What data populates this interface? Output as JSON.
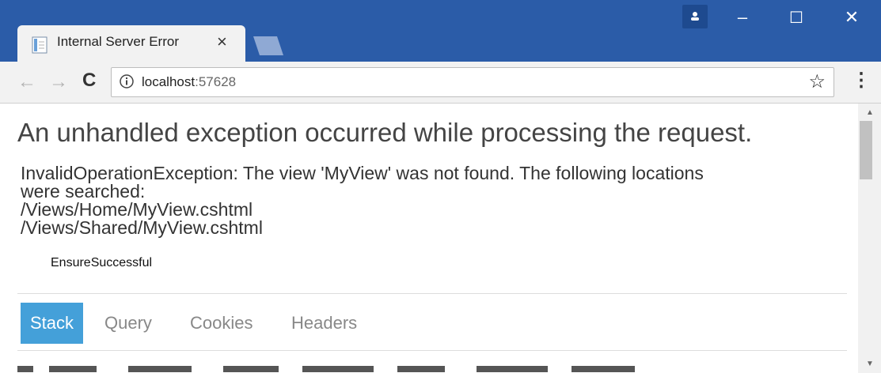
{
  "browser": {
    "tab_title": "Internal Server Error",
    "tab_close": "×",
    "window_minimize": "–",
    "window_maximize": "☐",
    "window_close": "✕",
    "nav_back": "←",
    "nav_forward": "→",
    "reload": "C",
    "address_host": "localhost",
    "address_port": ":57628",
    "bookmark_star": "☆",
    "menu_dots": "⋮"
  },
  "page": {
    "heading": "An unhandled exception occurred while processing the request.",
    "message_line1": "InvalidOperationException: The view 'MyView' was not found. The following locations",
    "message_line2": "were searched:",
    "message_line3": "/Views/Home/MyView.cshtml",
    "message_line4": "/Views/Shared/MyView.cshtml",
    "source": "EnsureSuccessful",
    "tabs": [
      {
        "label": "Stack"
      },
      {
        "label": "Query"
      },
      {
        "label": "Cookies"
      },
      {
        "label": "Headers"
      }
    ],
    "accent_color": "#44a0d9"
  },
  "colors": {
    "titlebar": "#2b5ca8",
    "toolbar": "#f2f2f2"
  },
  "icons": [
    "document-icon",
    "new-tab-icon",
    "profile-icon",
    "info-icon",
    "star-icon",
    "kebab-menu-icon"
  ]
}
